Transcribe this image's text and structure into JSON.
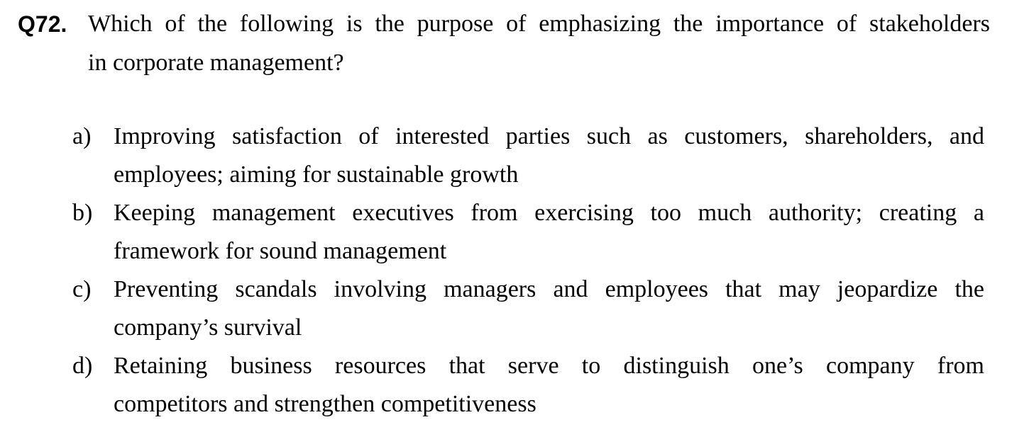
{
  "question": {
    "number": "Q72.",
    "text_lines": [
      "Which of the following is the purpose of emphasizing the importance of stakeholders",
      "in corporate management?"
    ]
  },
  "options": [
    {
      "letter": "a)",
      "lines": [
        "Improving satisfaction of interested parties such as customers, shareholders, and",
        "employees; aiming for sustainable growth"
      ]
    },
    {
      "letter": "b)",
      "lines": [
        "Keeping management executives from exercising too much authority; creating a",
        "framework for sound management"
      ]
    },
    {
      "letter": "c)",
      "lines": [
        "Preventing scandals involving managers and employees that may jeopardize the",
        "company’s survival"
      ]
    },
    {
      "letter": "d)",
      "lines": [
        "Retaining business resources that serve to distinguish one’s company from",
        "competitors and strengthen competitiveness"
      ]
    }
  ]
}
